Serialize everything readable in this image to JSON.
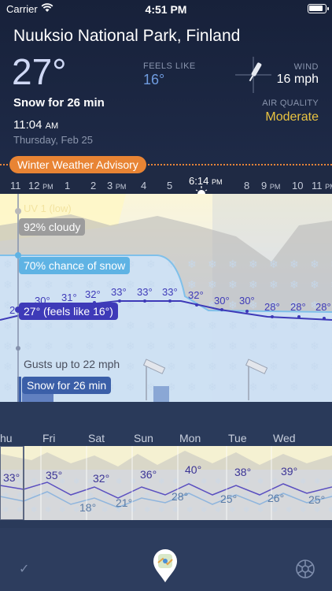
{
  "status": {
    "carrier": "Carrier",
    "time": "4:51 PM"
  },
  "location": "Nuuksio National Park, Finland",
  "current": {
    "temp": "27°",
    "condition": "Snow for 26 min",
    "clock": "11:04",
    "clock_suffix": "AM",
    "date": "Thursday, Feb 25",
    "feels_label": "FEELS LIKE",
    "feels_value": "16°",
    "wind_label": "WIND",
    "wind_value": "16 mph",
    "aq_label": "AIR QUALITY",
    "aq_value": "Moderate"
  },
  "advisory": "Winter Weather Advisory",
  "hours": [
    {
      "num": "11",
      "suffix": ""
    },
    {
      "num": "12",
      "suffix": "PM"
    },
    {
      "num": "1",
      "suffix": ""
    },
    {
      "num": "2",
      "suffix": ""
    },
    {
      "num": "3",
      "suffix": "PM"
    },
    {
      "num": "4",
      "suffix": ""
    },
    {
      "num": "5",
      "suffix": ""
    },
    {
      "num": "6:14",
      "suffix": "PM"
    },
    {
      "num": "8",
      "suffix": ""
    },
    {
      "num": "9",
      "suffix": "PM"
    },
    {
      "num": "10",
      "suffix": ""
    },
    {
      "num": "11",
      "suffix": "PM"
    }
  ],
  "chart": {
    "uv_label": "UV 1 (low)",
    "cloud_label": "92% cloudy",
    "snow_label": "70% chance of snow",
    "temp_label": "27° (feels like 16°)",
    "gust_label": "Gusts up to 22 mph",
    "precip_label": "Snow for 26 min",
    "temps": [
      "2",
      "30°",
      "31°",
      "32°",
      "33°",
      "33°",
      "33°",
      "32°",
      "30°",
      "30°",
      "28°",
      "28°",
      "28°"
    ]
  },
  "days": [
    {
      "name": "hu",
      "hi": "33°",
      "lo": ""
    },
    {
      "name": "Fri",
      "hi": "35°",
      "lo": ""
    },
    {
      "name": "Sat",
      "hi": "32°",
      "lo": "18°"
    },
    {
      "name": "Sun",
      "hi": "36°",
      "lo": "21°"
    },
    {
      "name": "Mon",
      "hi": "40°",
      "lo": "28°"
    },
    {
      "name": "Tue",
      "hi": "38°",
      "lo": "25°"
    },
    {
      "name": "Wed",
      "hi": "39°",
      "lo": "26°"
    },
    {
      "name": "",
      "hi": "",
      "lo": "25°"
    }
  ],
  "colors": {
    "accent": "#e88434",
    "air_quality": "#e9c341",
    "snow": "#5fb3e4",
    "temperature": "#3e3ab8",
    "cloud": "#9c9c9c"
  }
}
